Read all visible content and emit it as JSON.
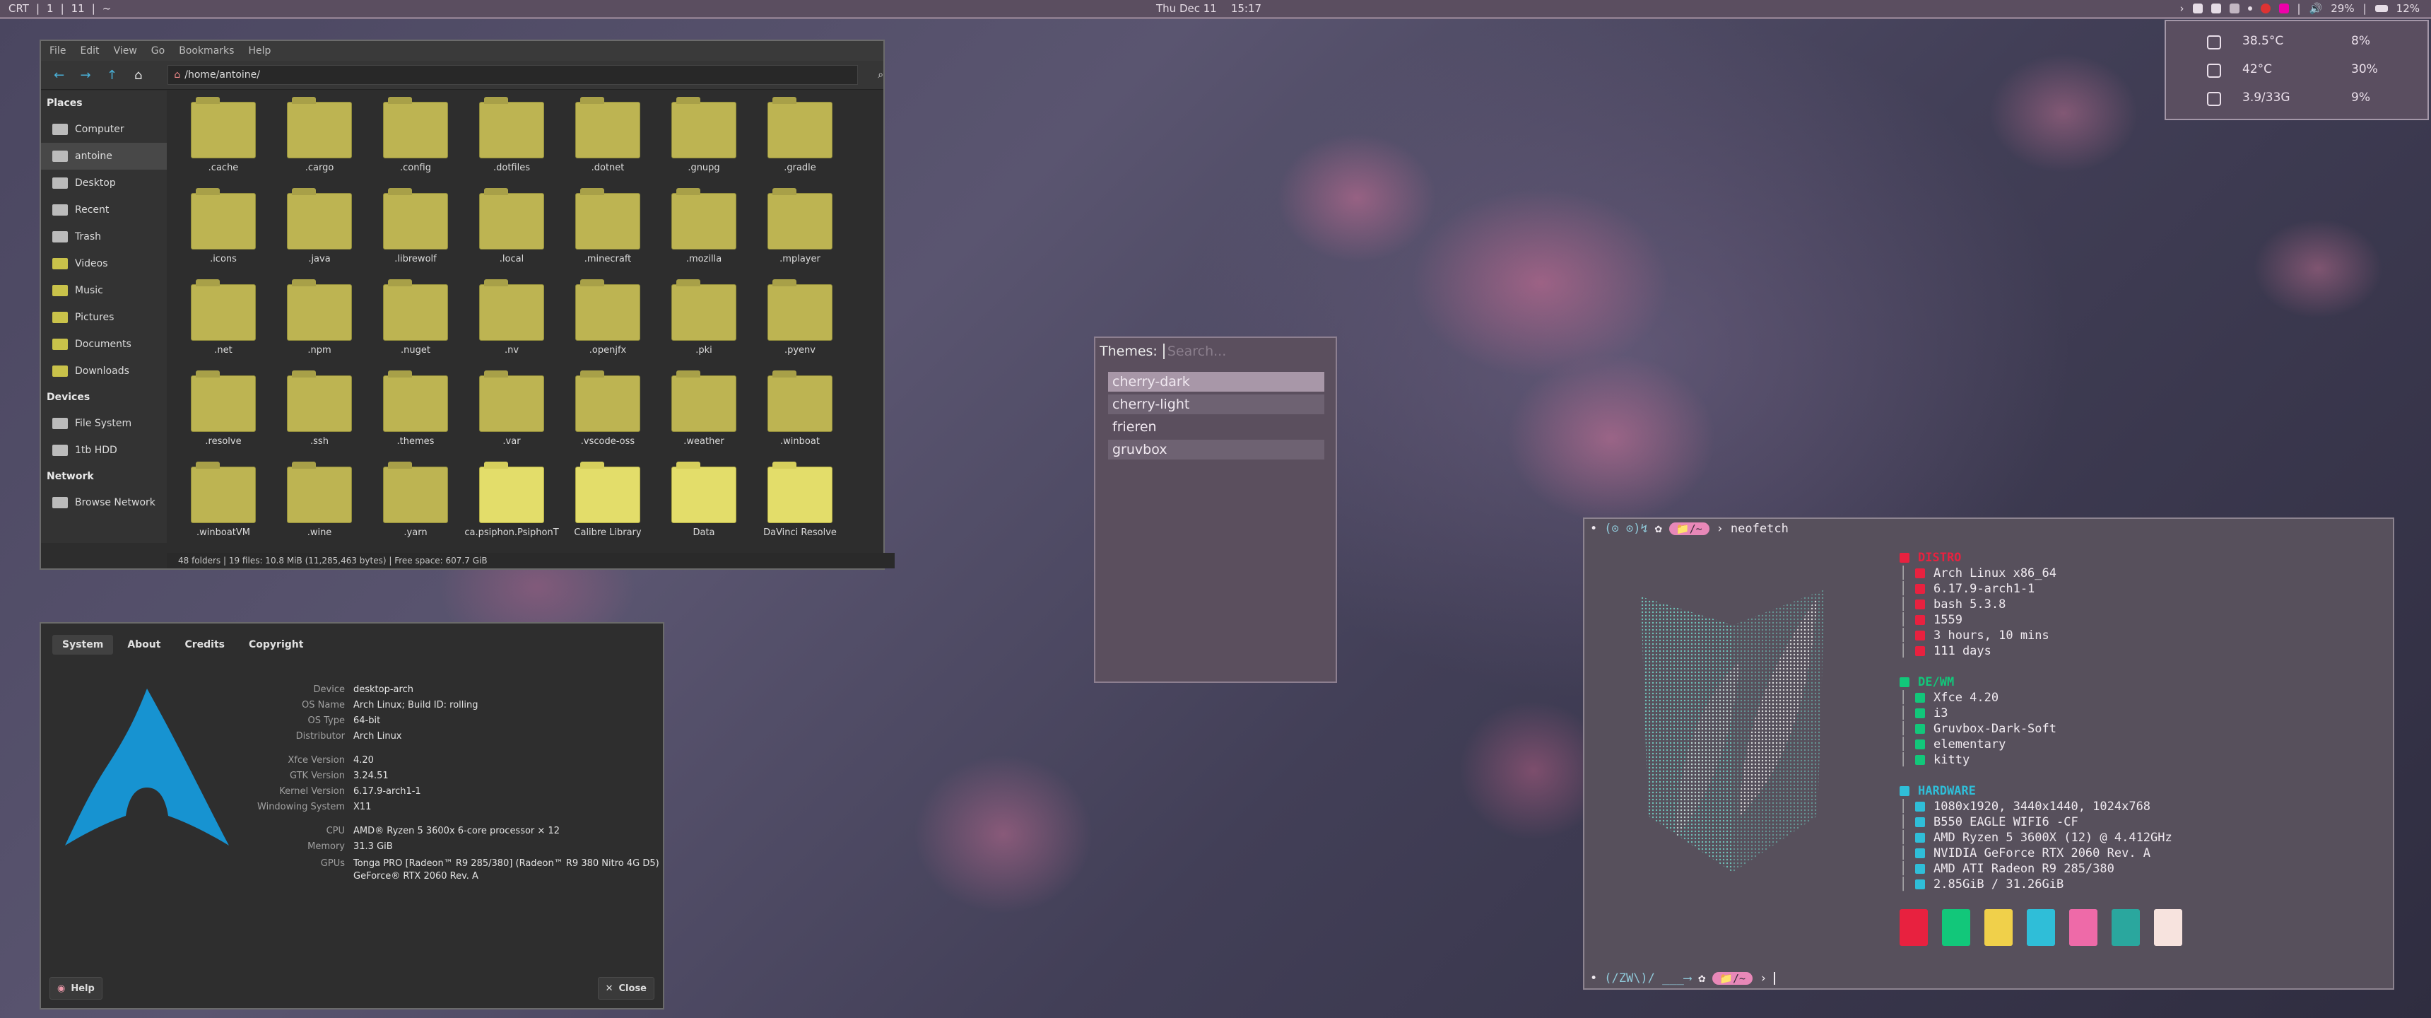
{
  "topbar": {
    "wm": "CRT",
    "ws1": "1",
    "ws2": "11",
    "ws3": "~",
    "date": "Thu Dec 11",
    "time": "15:17",
    "volume": "29%",
    "battery": "12%"
  },
  "sysmon": [
    {
      "icon": "cpu-icon",
      "a": "38.5°C",
      "b": "8%"
    },
    {
      "icon": "gpu-icon",
      "a": "42°C",
      "b": "30%"
    },
    {
      "icon": "memory-icon",
      "a": "3.9/33G",
      "b": "9%"
    }
  ],
  "filemanager": {
    "menu": [
      "File",
      "Edit",
      "View",
      "Go",
      "Bookmarks",
      "Help"
    ],
    "path": "/home/antoine/",
    "places_header": "Places",
    "places": [
      "Computer",
      "antoine",
      "Desktop",
      "Recent",
      "Trash",
      "Videos",
      "Music",
      "Pictures",
      "Documents",
      "Downloads"
    ],
    "devices_header": "Devices",
    "devices": [
      "File System",
      "1tb HDD"
    ],
    "network_header": "Network",
    "network": [
      "Browse Network"
    ],
    "folders": [
      ".cache",
      ".cargo",
      ".config",
      ".dotfiles",
      ".dotnet",
      ".gnupg",
      ".gradle",
      ".icons",
      ".java",
      ".librewolf",
      ".local",
      ".minecraft",
      ".mozilla",
      ".mplayer",
      ".net",
      ".npm",
      ".nuget",
      ".nv",
      ".openjfx",
      ".pki",
      ".pyenv",
      ".resolve",
      ".ssh",
      ".themes",
      ".var",
      ".vscode-oss",
      ".weather",
      ".winboat",
      ".winboatVM",
      ".wine",
      ".yarn",
      "ca.psiphon.PsiphonT",
      "Calibre Library",
      "Data",
      "DaVinci Resolve"
    ],
    "status": "48 folders  |  19 files: 10.8 MiB (11,285,463 bytes)  |  Free space: 607.7 GiB"
  },
  "about": {
    "tabs": [
      "System",
      "About",
      "Credits",
      "Copyright"
    ],
    "rows": [
      {
        "label": "Device",
        "value": "desktop-arch"
      },
      {
        "label": "OS Name",
        "value": "Arch Linux; Build ID: rolling"
      },
      {
        "label": "OS Type",
        "value": "64-bit"
      },
      {
        "label": "Distributor",
        "value": "Arch Linux"
      },
      {
        "label": "Xfce Version",
        "value": "4.20"
      },
      {
        "label": "GTK Version",
        "value": "3.24.51"
      },
      {
        "label": "Kernel Version",
        "value": "6.17.9-arch1-1"
      },
      {
        "label": "Windowing System",
        "value": "X11"
      },
      {
        "label": "CPU",
        "value": "AMD® Ryzen 5 3600x 6-core processor × 12"
      },
      {
        "label": "Memory",
        "value": "31.3 GiB"
      },
      {
        "label": "GPUs",
        "value": "Tonga PRO [Radeon™ R9 285/380] (Radeon™ R9 380 Nitro 4G D5)"
      },
      {
        "label": "",
        "value": "GeForce® RTX 2060 Rev. A"
      }
    ],
    "help": "Help",
    "close": "Close"
  },
  "rofi": {
    "prompt": "Themes:",
    "placeholder": "Search...",
    "items": [
      "cherry-dark",
      "cherry-light",
      "frieren",
      "gruvbox"
    ]
  },
  "terminal": {
    "prompt_symbols": "(⊙ ⊙)↯",
    "dir": "📁/~",
    "command": "neofetch",
    "bottom_prompt": "(/ZW\\)/ ___⟶",
    "distro_header": "DISTRO",
    "distro": [
      "Arch Linux x86_64",
      "6.17.9-arch1-1",
      "bash 5.3.8",
      "1559",
      "3 hours, 10 mins",
      "111 days"
    ],
    "dewm_header": "DE/WM",
    "dewm": [
      "Xfce 4.20",
      "i3",
      "Gruvbox-Dark-Soft",
      "elementary",
      "kitty"
    ],
    "hardware_header": "HARDWARE",
    "hardware": [
      "1080x1920, 3440x1440, 1024x768",
      "B550 EAGLE WIFI6 -CF",
      "AMD Ryzen 5 3600X (12) @ 4.412GHz",
      "NVIDIA GeForce RTX 2060 Rev. A",
      "AMD ATI Radeon R9 285/380",
      "2.85GiB / 31.26GiB"
    ],
    "colors": [
      "#e8213f",
      "#12c77a",
      "#f0d04a",
      "#2fbed8",
      "#ee6aa8",
      "#2aa79e",
      "#f7e3de"
    ]
  }
}
